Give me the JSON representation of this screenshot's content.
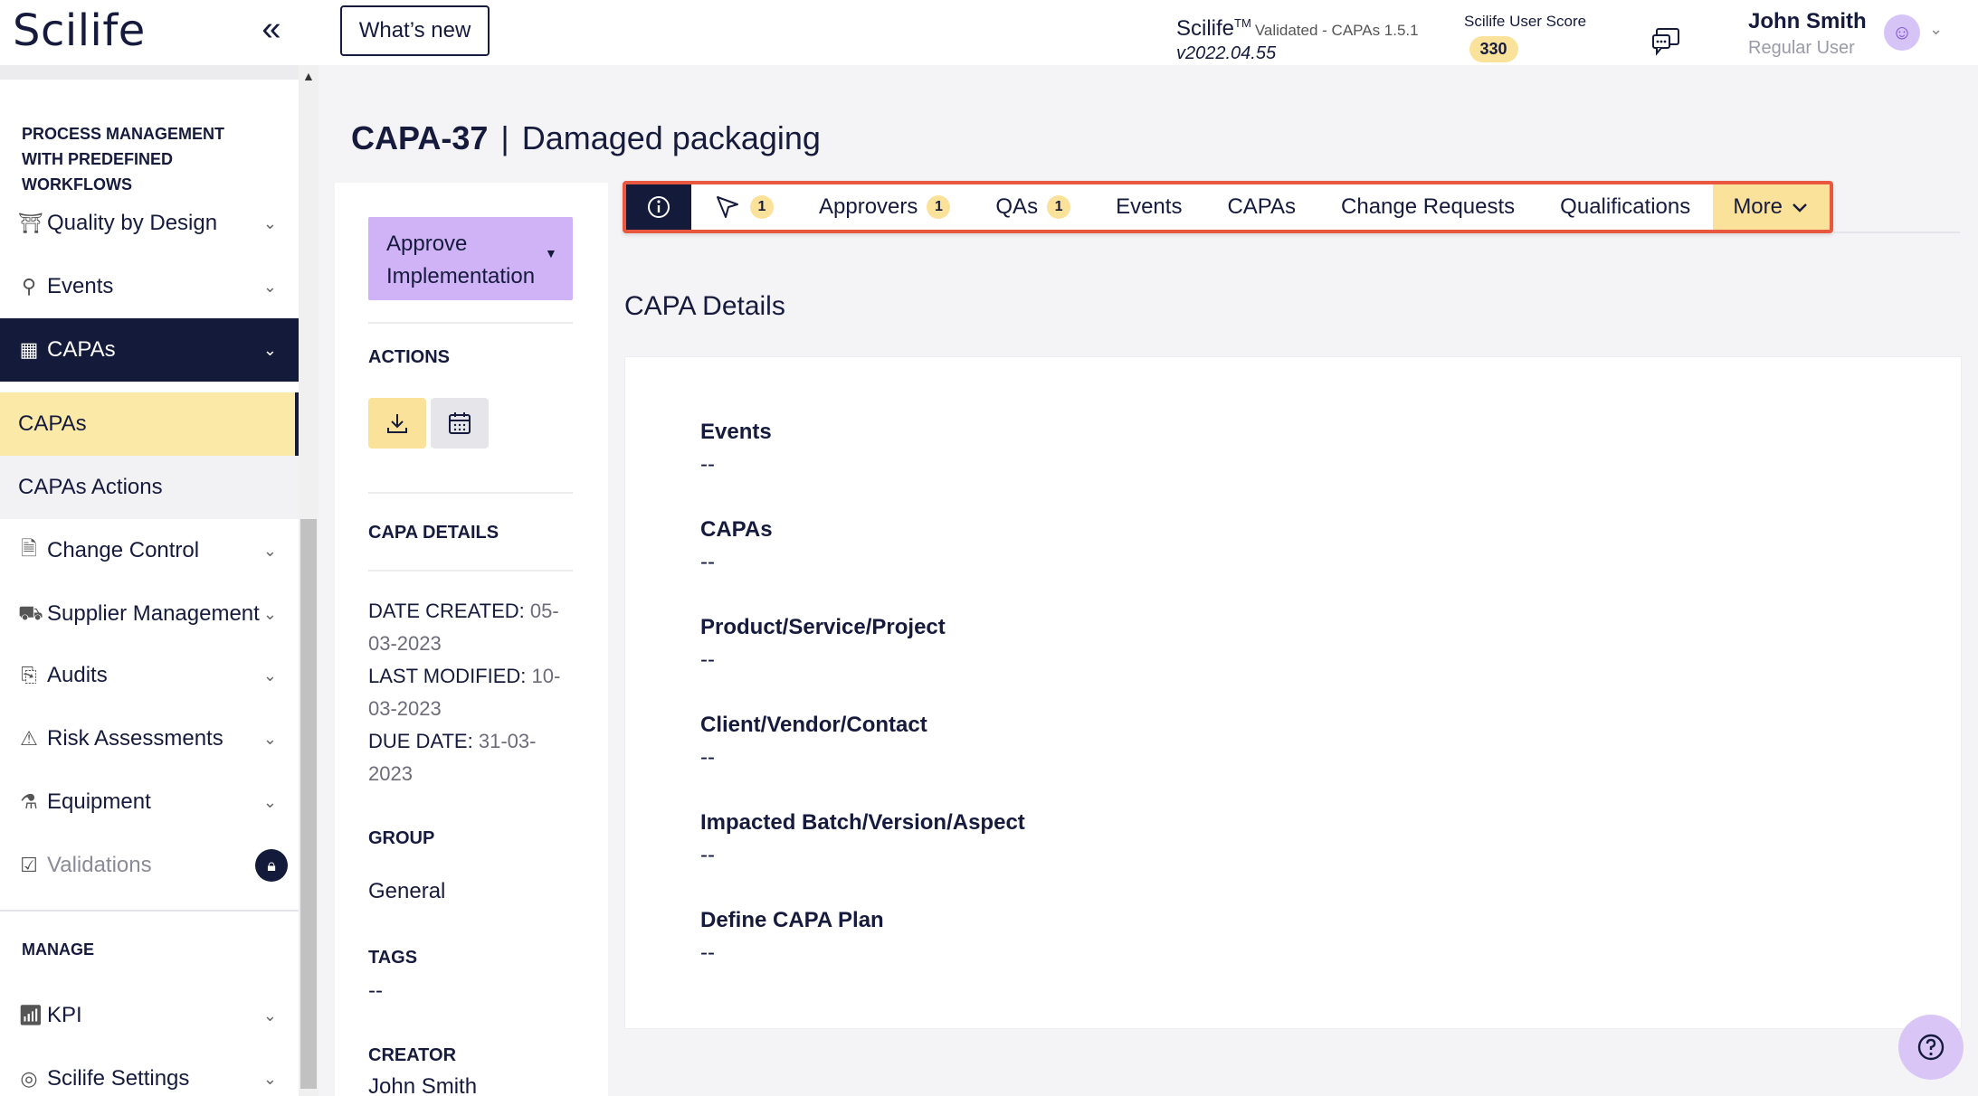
{
  "header": {
    "logo": "Scilife",
    "collapse_icon": "double-chevron-left",
    "whats_new": "What’s new",
    "app_name": "Scilife",
    "trademark": "TM",
    "validated": "Validated - CAPAs 1.5.1",
    "version": "v2022.04.55",
    "score_label": "Scilife User Score",
    "score_value": "330",
    "user_name": "John Smith",
    "user_role": "Regular User"
  },
  "sidebar": {
    "section_process": "PROCESS MANAGEMENT WITH PREDEFINED WORKFLOWS",
    "items": [
      {
        "label": "Quality by Design",
        "icon": "bridge-icon"
      },
      {
        "label": "Events",
        "icon": "pin-icon"
      },
      {
        "label": "CAPAs",
        "icon": "chart-icon"
      },
      {
        "label": "Change Control",
        "icon": "document-icon"
      },
      {
        "label": "Supplier Management",
        "icon": "truck-icon"
      },
      {
        "label": "Audits",
        "icon": "clipboard-search-icon"
      },
      {
        "label": "Risk Assessments",
        "icon": "warning-icon"
      },
      {
        "label": "Equipment",
        "icon": "flask-icon"
      },
      {
        "label": "Validations",
        "icon": "clipboard-check-icon"
      }
    ],
    "subitems": [
      "CAPAs",
      "CAPAs Actions"
    ],
    "section_manage": "MANAGE",
    "manage_items": [
      {
        "label": "KPI",
        "icon": "bar-chart-icon"
      },
      {
        "label": "Scilife Settings",
        "icon": "settings-icon"
      }
    ]
  },
  "page": {
    "id": "CAPA-37",
    "separator": "|",
    "title": "Damaged packaging"
  },
  "panel": {
    "approve_line1": "Approve",
    "approve_line2": "Implementation",
    "actions_heading": "ACTIONS",
    "details_heading": "CAPA DETAILS",
    "date_created_label": "DATE CREATED:",
    "date_created_value_a": "05-",
    "date_created_value_b": "03-2023",
    "last_modified_label": "LAST MODIFIED:",
    "last_modified_value_a": "10-",
    "last_modified_value_b": "03-2023",
    "due_date_label": "DUE DATE:",
    "due_date_value_a": "31-03-",
    "due_date_value_b": "2023",
    "group_heading": "GROUP",
    "group_value": "General",
    "tags_heading": "TAGS",
    "tags_value": "--",
    "creator_heading": "CREATOR",
    "creator_value": "John Smith"
  },
  "tabs": {
    "workflow_count": "1",
    "approvers": "Approvers",
    "approvers_count": "1",
    "qas": "QAs",
    "qas_count": "1",
    "events": "Events",
    "capas": "CAPAs",
    "change_requests": "Change Requests",
    "qualifications": "Qualifications",
    "more": "More"
  },
  "details": {
    "section_title": "CAPA Details",
    "fields": [
      {
        "label": "Events",
        "value": "--"
      },
      {
        "label": "CAPAs",
        "value": "--"
      },
      {
        "label": "Product/Service/Project",
        "value": "--"
      },
      {
        "label": "Client/Vendor/Contact",
        "value": "--"
      },
      {
        "label": "Impacted Batch/Version/Aspect",
        "value": "--"
      },
      {
        "label": "Define CAPA Plan",
        "value": "--"
      }
    ]
  },
  "colors": {
    "navy": "#141a3a",
    "highlight_yellow": "#fbeaa7",
    "badge_yellow": "#fbe29a",
    "approve_purple": "#cfb3f6",
    "tab_border": "#e9573f"
  }
}
